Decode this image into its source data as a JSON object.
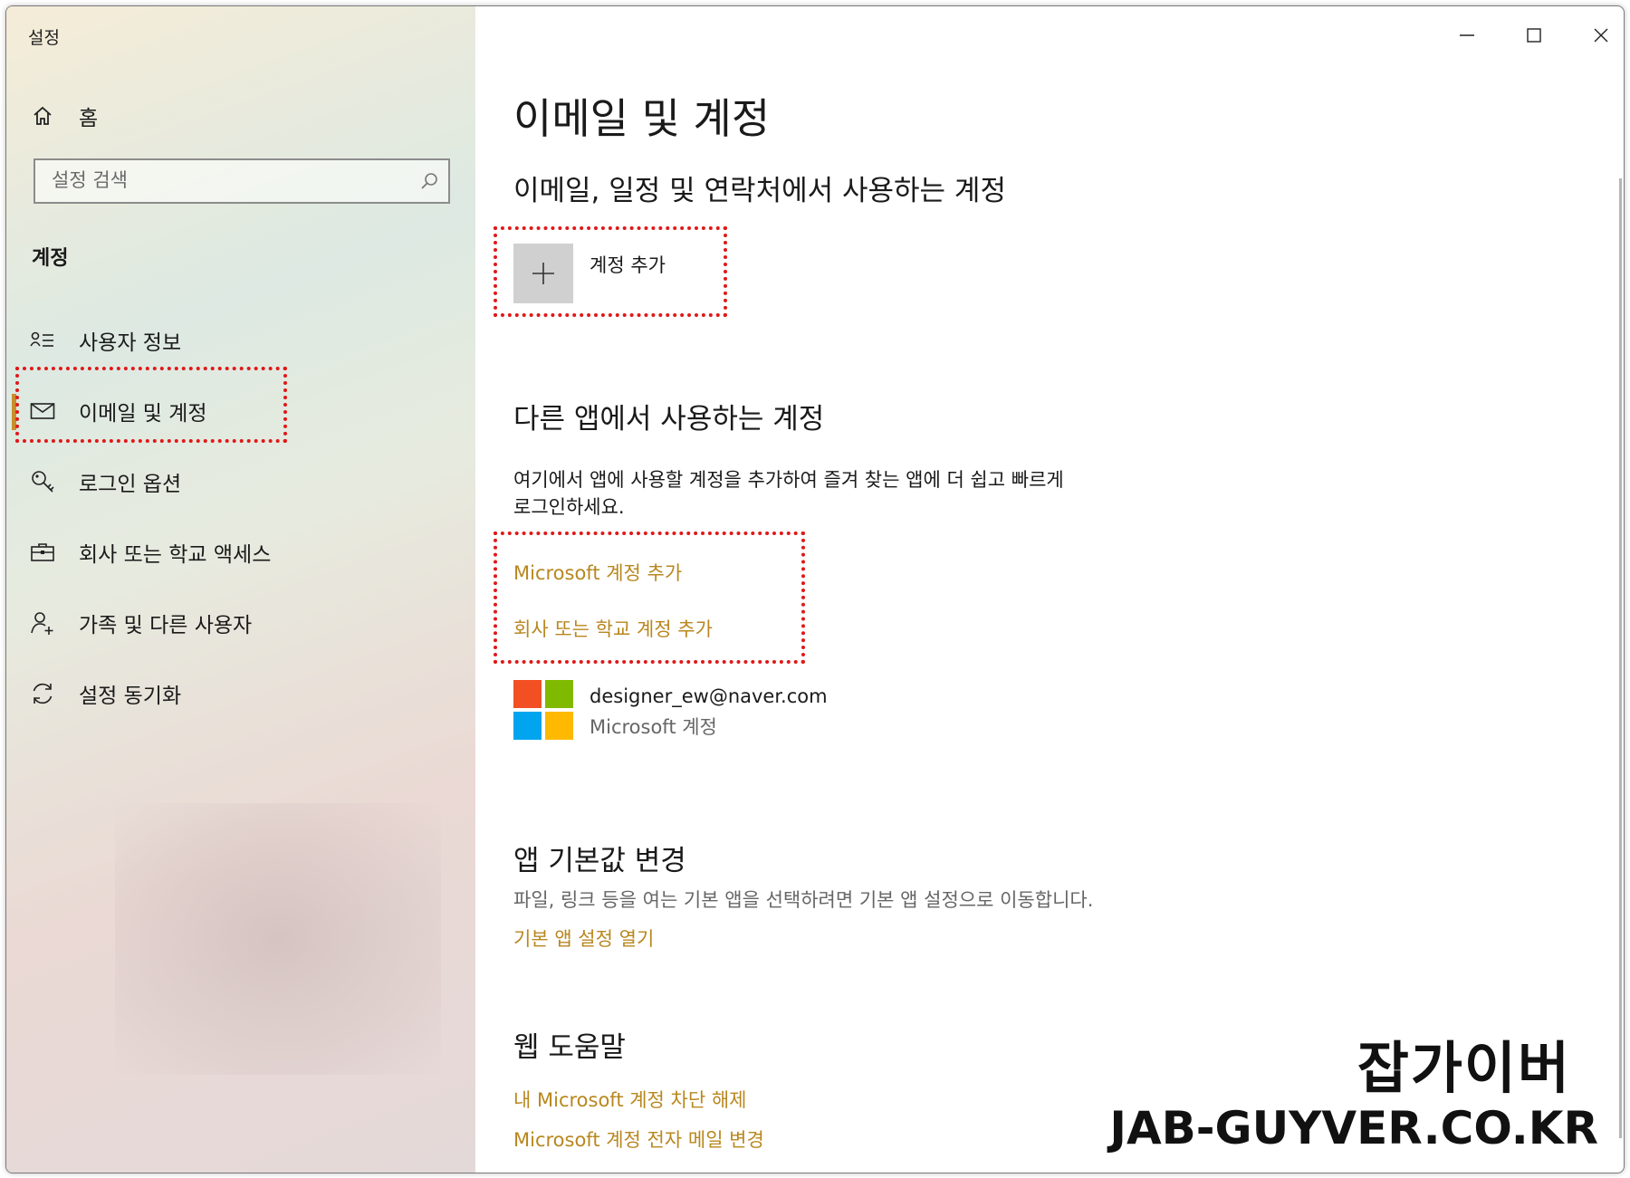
{
  "window": {
    "title": "설정"
  },
  "sidebar": {
    "home_label": "홈",
    "search_placeholder": "설정 검색",
    "section_title": "계정",
    "items": [
      {
        "label": "사용자 정보",
        "icon": "user-info-icon"
      },
      {
        "label": "이메일 및 계정",
        "icon": "mail-icon",
        "selected": true
      },
      {
        "label": "로그인 옵션",
        "icon": "key-icon"
      },
      {
        "label": "회사 또는 학교 액세스",
        "icon": "briefcase-icon"
      },
      {
        "label": "가족 및 다른 사용자",
        "icon": "add-person-icon"
      },
      {
        "label": "설정 동기화",
        "icon": "sync-icon"
      }
    ]
  },
  "main": {
    "title": "이메일 및 계정",
    "email_section": {
      "heading": "이메일, 일정 및 연락처에서 사용하는 계정",
      "add_account_label": "계정 추가"
    },
    "other_apps_section": {
      "heading": "다른 앱에서 사용하는 계정",
      "description_line1": "여기에서 앱에 사용할 계정을 추가하여 즐겨 찾는 앱에 더 쉽고 빠르게",
      "description_line2": "로그인하세요.",
      "add_microsoft_link": "Microsoft 계정 추가",
      "add_work_link": "회사 또는 학교 계정 추가",
      "account": {
        "email": "designer_ew@naver.com",
        "type": "Microsoft 계정"
      }
    },
    "app_defaults_section": {
      "heading": "앱 기본값 변경",
      "description": "파일, 링크 등을 여는 기본 앱을 선택하려면 기본 앱 설정으로 이동합니다.",
      "link": "기본 앱 설정 열기"
    },
    "web_help_section": {
      "heading": "웹 도움말",
      "links": [
        "내 Microsoft 계정 차단 해제",
        "Microsoft 계정 전자 메일 변경"
      ]
    }
  },
  "watermark": {
    "line1": "잡가이버",
    "line2": "JAB-GUYVER.CO.KR"
  },
  "colors": {
    "accent": "#c88f2c",
    "link": "#b8871f",
    "highlight_box": "#e01818"
  }
}
